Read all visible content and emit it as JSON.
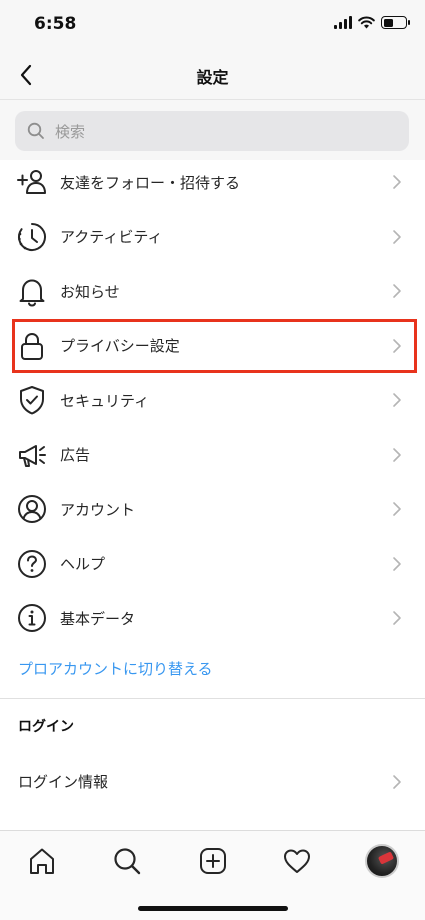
{
  "status_bar": {
    "time": "6:58"
  },
  "header": {
    "title": "設定"
  },
  "search": {
    "placeholder": "検索"
  },
  "menu": {
    "items": [
      {
        "label": "友達をフォロー・招待する",
        "icon": "add-person-icon"
      },
      {
        "label": "アクティビティ",
        "icon": "activity-clock-icon"
      },
      {
        "label": "お知らせ",
        "icon": "bell-icon"
      },
      {
        "label": "プライバシー設定",
        "icon": "lock-icon"
      },
      {
        "label": "セキュリティ",
        "icon": "shield-check-icon"
      },
      {
        "label": "広告",
        "icon": "megaphone-icon"
      },
      {
        "label": "アカウント",
        "icon": "account-icon"
      },
      {
        "label": "ヘルプ",
        "icon": "help-icon"
      },
      {
        "label": "基本データ",
        "icon": "info-icon"
      }
    ]
  },
  "pro_account_link": "プロアカウントに切り替える",
  "login_section": {
    "header": "ログイン",
    "items": [
      {
        "label": "ログイン情報"
      }
    ]
  },
  "colors": {
    "accent": "#3897f0",
    "highlight": "#e8331c"
  }
}
